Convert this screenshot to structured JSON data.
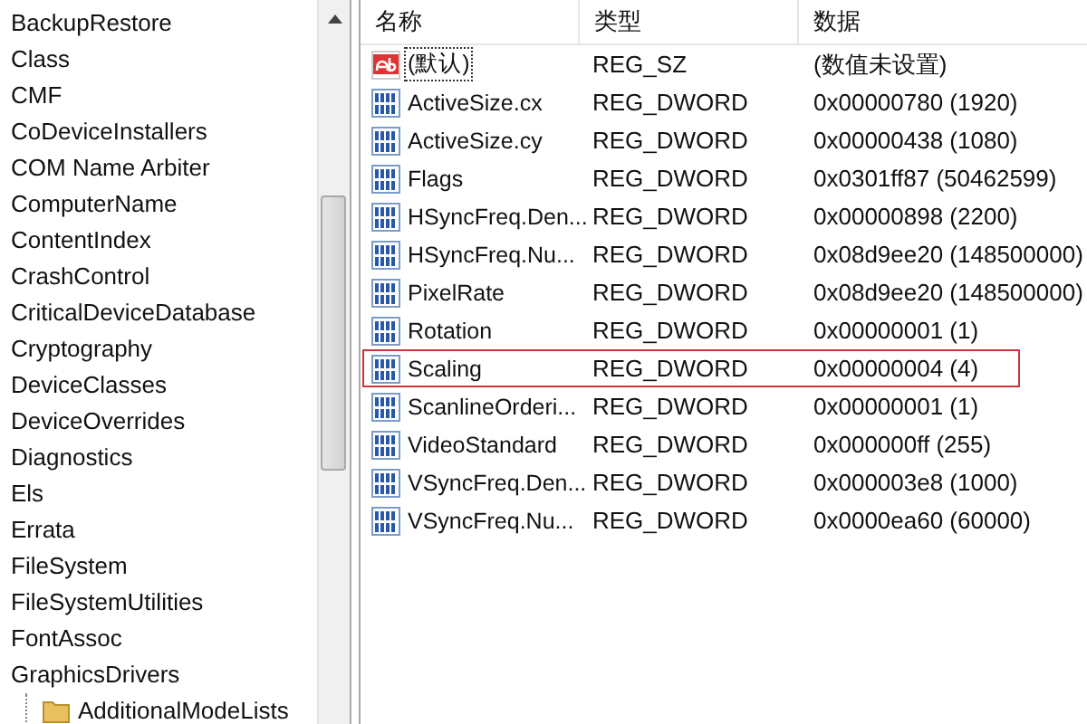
{
  "tree": {
    "items": [
      {
        "label": "BackupRestore"
      },
      {
        "label": "Class"
      },
      {
        "label": "CMF"
      },
      {
        "label": "CoDeviceInstallers"
      },
      {
        "label": "COM Name Arbiter"
      },
      {
        "label": "ComputerName"
      },
      {
        "label": "ContentIndex"
      },
      {
        "label": "CrashControl"
      },
      {
        "label": "CriticalDeviceDatabase"
      },
      {
        "label": "Cryptography"
      },
      {
        "label": "DeviceClasses"
      },
      {
        "label": "DeviceOverrides"
      },
      {
        "label": "Diagnostics"
      },
      {
        "label": "Els"
      },
      {
        "label": "Errata"
      },
      {
        "label": "FileSystem"
      },
      {
        "label": "FileSystemUtilities"
      },
      {
        "label": "FontAssoc"
      },
      {
        "label": "GraphicsDrivers",
        "children": [
          {
            "label": "AdditionalModeLists"
          }
        ]
      }
    ]
  },
  "values": {
    "columns": [
      "名称",
      "类型",
      "数据"
    ],
    "rows": [
      {
        "kind": "string",
        "name": "(默认)",
        "type": "REG_SZ",
        "data": "(数值未设置)",
        "focused": true,
        "outlined": false
      },
      {
        "kind": "dword",
        "name": "ActiveSize.cx",
        "type": "REG_DWORD",
        "data": "0x00000780 (1920)",
        "focused": false,
        "outlined": false
      },
      {
        "kind": "dword",
        "name": "ActiveSize.cy",
        "type": "REG_DWORD",
        "data": "0x00000438 (1080)",
        "focused": false,
        "outlined": false
      },
      {
        "kind": "dword",
        "name": "Flags",
        "type": "REG_DWORD",
        "data": "0x0301ff87 (50462599)",
        "focused": false,
        "outlined": false
      },
      {
        "kind": "dword",
        "name": "HSyncFreq.Den...",
        "type": "REG_DWORD",
        "data": "0x00000898 (2200)",
        "focused": false,
        "outlined": false
      },
      {
        "kind": "dword",
        "name": "HSyncFreq.Nu...",
        "type": "REG_DWORD",
        "data": "0x08d9ee20 (148500000)",
        "focused": false,
        "outlined": false
      },
      {
        "kind": "dword",
        "name": "PixelRate",
        "type": "REG_DWORD",
        "data": "0x08d9ee20 (148500000)",
        "focused": false,
        "outlined": false
      },
      {
        "kind": "dword",
        "name": "Rotation",
        "type": "REG_DWORD",
        "data": "0x00000001 (1)",
        "focused": false,
        "outlined": false
      },
      {
        "kind": "dword",
        "name": "Scaling",
        "type": "REG_DWORD",
        "data": "0x00000004 (4)",
        "focused": false,
        "outlined": true
      },
      {
        "kind": "dword",
        "name": "ScanlineOrderi...",
        "type": "REG_DWORD",
        "data": "0x00000001 (1)",
        "focused": false,
        "outlined": false
      },
      {
        "kind": "dword",
        "name": "VideoStandard",
        "type": "REG_DWORD",
        "data": "0x000000ff (255)",
        "focused": false,
        "outlined": false
      },
      {
        "kind": "dword",
        "name": "VSyncFreq.Den...",
        "type": "REG_DWORD",
        "data": "0x000003e8 (1000)",
        "focused": false,
        "outlined": false
      },
      {
        "kind": "dword",
        "name": "VSyncFreq.Nu...",
        "type": "REG_DWORD",
        "data": "0x0000ea60 (60000)",
        "focused": false,
        "outlined": false
      }
    ]
  }
}
